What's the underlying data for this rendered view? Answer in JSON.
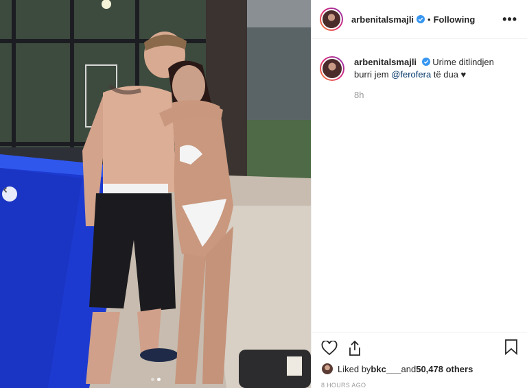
{
  "header": {
    "username": "arbenitalsmajli",
    "separator": "•",
    "follow_status": "Following",
    "more": "•••"
  },
  "caption": {
    "username": "arbenitalsmajli",
    "text_before": "Urime ditlindjen burri jem ",
    "mention": "@ferofera",
    "text_after": " të dua ♥",
    "time": "8h"
  },
  "likes": {
    "prefix": "Liked by ",
    "liker": "bkc___",
    "middle": " and ",
    "count": "50,478 others"
  },
  "posted_time": "8 HOURS AGO",
  "carousel": {
    "slides": 2,
    "active_index": 1
  },
  "icons": {
    "verified": "verified-badge-icon",
    "like": "heart-icon",
    "share": "share-icon",
    "save": "bookmark-icon",
    "prev": "chevron-left-icon"
  },
  "colors": {
    "verified": "#3897f0",
    "text": "#262626",
    "muted": "#999999",
    "mention": "#003569",
    "pool": "#1f3fd8"
  }
}
